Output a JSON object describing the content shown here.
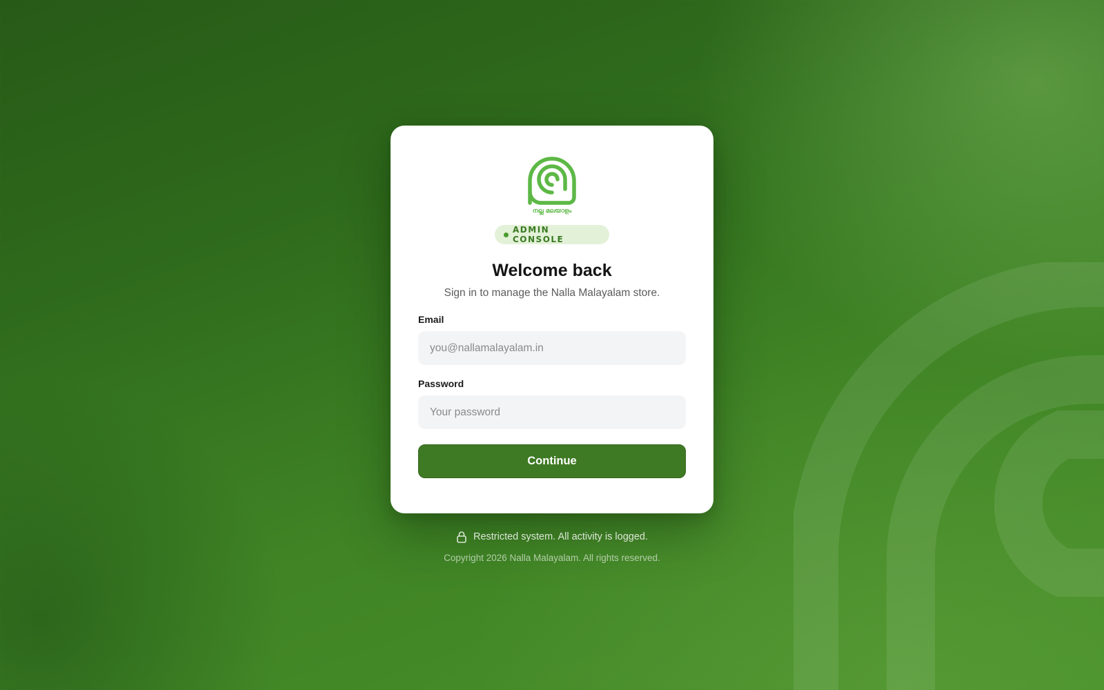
{
  "colors": {
    "brand_green": "#3e7a24",
    "logo_green": "#5db846",
    "badge_bg": "#e3f1d8",
    "badge_text": "#3a7a22",
    "input_bg": "#f3f4f6"
  },
  "logo": {
    "icon": "nalla-malayalam-spiral-logo",
    "wordmark": "നല്ല മലയാളം"
  },
  "badge": {
    "label": "ADMIN CONSOLE"
  },
  "card": {
    "title": "Welcome back",
    "subtitle": "Sign in to manage the Nalla Malayalam store."
  },
  "form": {
    "email": {
      "label": "Email",
      "placeholder": "you@nallamalayalam.in",
      "value": ""
    },
    "password": {
      "label": "Password",
      "placeholder": "Your password",
      "value": ""
    },
    "submit_label": "Continue"
  },
  "footer": {
    "notice_icon": "lock-icon",
    "notice": "Restricted system. All activity is logged.",
    "copyright": "Copyright 2026 Nalla Malayalam. All rights reserved."
  }
}
